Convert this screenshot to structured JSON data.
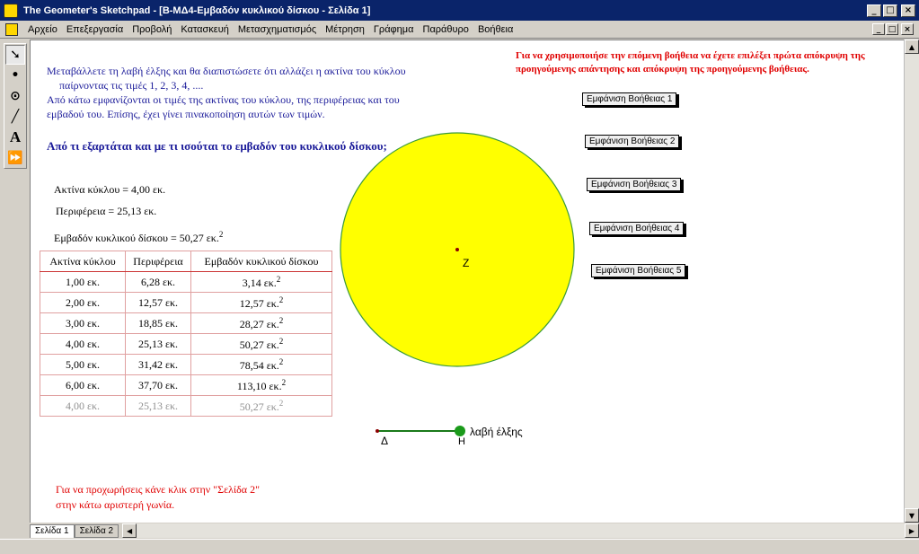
{
  "window": {
    "title": "The Geometer's Sketchpad - [Β-ΜΔ4-Εμβαδόν κυκλικού δίσκου - Σελίδα 1]",
    "controls": [
      "_",
      "□",
      "×"
    ]
  },
  "menu": {
    "items": [
      "Αρχείο",
      "Επεξεργασία",
      "Προβολή",
      "Κατασκευή",
      "Μετασχηματισμός",
      "Μέτρηση",
      "Γράφημα",
      "Παράθυρο",
      "Βοήθεια"
    ],
    "doc_controls": [
      "_",
      "□",
      "×"
    ]
  },
  "toolbox": {
    "tools": [
      "arrow-tool",
      "point-tool",
      "compass-tool",
      "straightedge-tool",
      "text-tool",
      "custom-tool"
    ],
    "glyphs": [
      "➘",
      "•",
      "⊙",
      "╱",
      "A",
      "⏩"
    ]
  },
  "content": {
    "intro_lines": [
      "Μεταβάλλετε τη λαβή έλξης και θα διαπιστώσετε ότι αλλάζει η ακτίνα του κύκλου",
      "παίρνοντας τις τιμές 1, 2, 3, 4, ....",
      "Από κάτω εμφανίζονται οι τιμές της ακτίνας του κύκλου, της περιφέρειας και του",
      "εμβαδού του. Επίσης, έχει γίνει πινακοποίηση αυτών των τιμών."
    ],
    "question": "Από τι εξαρτάται και με τι ισούται το εμβαδόν του κυκλικού δίσκου;",
    "help_note": "Για να χρησιμοποιήσε την επόμενη βοήθεια να έχετε επιλέξει πρώτα απόκρυψη της προηγούμενης απάντησης και απόκρυψη της προηγούμενης βοήθειας.",
    "help_buttons": [
      "Εμφάνιση Βοήθειας 1",
      "Εμφάνιση Βοήθειας 2",
      "Εμφάνιση Βοήθειας 3",
      "Εμφάνιση Βοήθειας 4",
      "Εμφάνιση Βοήθειας 5"
    ],
    "measurements": {
      "radius": "Ακτίνα κύκλου = 4,00 εκ.",
      "circumference": "Περιφέρεια = 25,13 εκ.",
      "area": "Εμβαδόν κυκλικού δίσκου = 50,27 εκ.",
      "area_sup": "2"
    },
    "table": {
      "headers": [
        "Ακτίνα κύκλου",
        "Περιφέρεια",
        "Εμβαδόν κυκλικού δίσκου"
      ],
      "rows": [
        [
          "1,00 εκ.",
          "6,28 εκ.",
          "3,14 εκ."
        ],
        [
          "2,00 εκ.",
          "12,57 εκ.",
          "12,57 εκ."
        ],
        [
          "3,00 εκ.",
          "18,85 εκ.",
          "28,27 εκ."
        ],
        [
          "4,00 εκ.",
          "25,13 εκ.",
          "50,27 εκ."
        ],
        [
          "5,00 εκ.",
          "31,42 εκ.",
          "78,54 εκ."
        ],
        [
          "6,00 εκ.",
          "37,70 εκ.",
          "113,10 εκ."
        ],
        [
          "4,00 εκ.",
          "25,13 εκ.",
          "50,27 εκ."
        ]
      ],
      "sup": "2"
    },
    "circle": {
      "center_label": "Z",
      "fill": "#ffff00",
      "stroke": "#3a9a3a"
    },
    "slider": {
      "start_label": "Δ",
      "end_label": "Η",
      "caption": "λαβή έλξης",
      "color": "#1a7a1a"
    },
    "footer_lines": [
      "Για να προχωρήσεις κάνε κλικ στην \"Σελίδα 2\"",
      "στην κάτω αριστερή γωνία."
    ]
  },
  "pages": [
    "Σελίδα 1",
    "Σελίδα 2"
  ],
  "colors": {
    "blue_text": "#1a1a99",
    "red_text": "#e00000",
    "title_bar": "#0a246a"
  }
}
